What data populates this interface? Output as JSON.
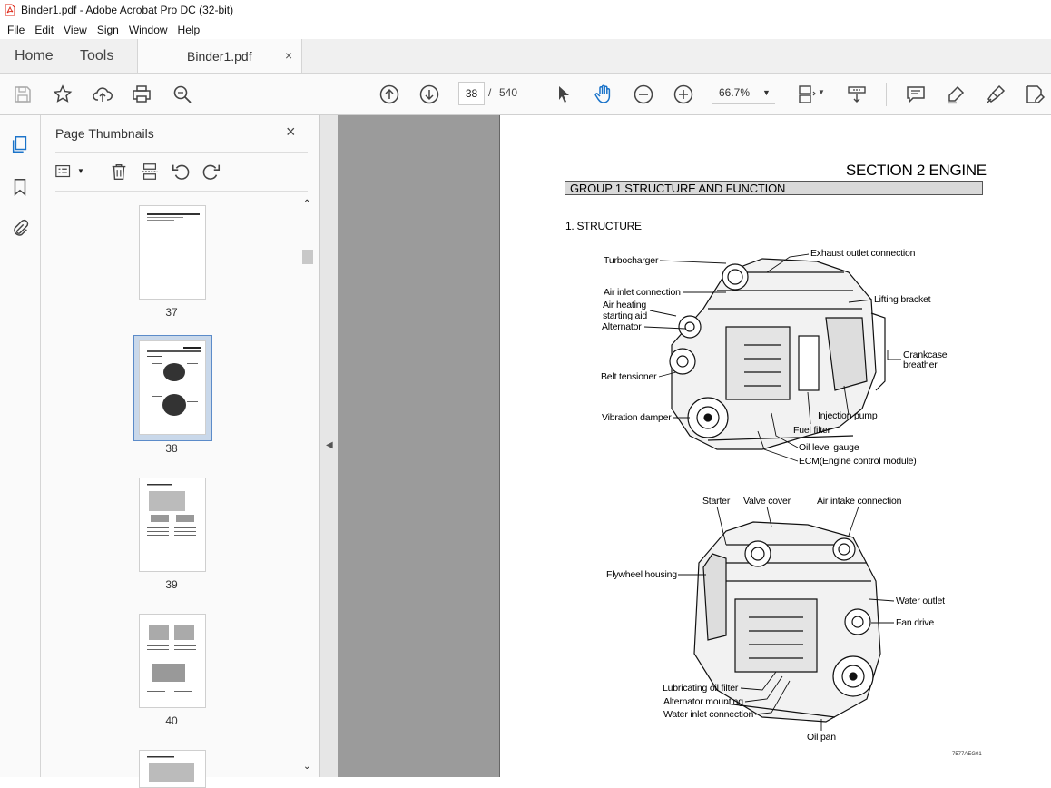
{
  "window": {
    "title": "Binder1.pdf - Adobe Acrobat Pro DC (32-bit)"
  },
  "menu": [
    "File",
    "Edit",
    "View",
    "Sign",
    "Window",
    "Help"
  ],
  "tabs": {
    "home": "Home",
    "tools": "Tools",
    "document": "Binder1.pdf",
    "close": "×"
  },
  "toolbar": {
    "page_current": "38",
    "page_separator": "/",
    "page_total": "540",
    "zoom": "66.7%"
  },
  "thumbnails_panel": {
    "title": "Page Thumbnails",
    "close": "×",
    "pages": [
      "37",
      "38",
      "39",
      "40"
    ],
    "selected_page": "38"
  },
  "page": {
    "section_title": "SECTION 2  ENGINE",
    "group_title": "GROUP  1  STRUCTURE AND FUNCTION",
    "subtitle": "1. STRUCTURE",
    "figure_code": "7577AEG01",
    "labels_top": {
      "turbocharger": "Turbocharger",
      "exhaust_outlet": "Exhaust outlet connection",
      "air_inlet": "Air inlet connection",
      "air_heating_1": "Air heating",
      "air_heating_2": "starting aid",
      "alternator": "Alternator",
      "lifting_bracket": "Lifting bracket",
      "crankcase_1": "Crankcase",
      "crankcase_2": "breather",
      "belt_tensioner": "Belt tensioner",
      "injection_pump": "Injection pump",
      "vibration_damper": "Vibration damper",
      "fuel_filter": "Fuel filter",
      "oil_level_gauge": "Oil level gauge",
      "ecm": "ECM(Engine control module)"
    },
    "labels_bottom": {
      "starter": "Starter",
      "valve_cover": "Valve cover",
      "air_intake": "Air intake connection",
      "flywheel_housing": "Flywheel housing",
      "water_outlet": "Water outlet",
      "fan_drive": "Fan drive",
      "lub_oil_filter": "Lubricating oil filter",
      "alternator_mounting": "Alternator mounting",
      "water_inlet": "Water inlet connection",
      "oil_pan": "Oil pan"
    }
  }
}
